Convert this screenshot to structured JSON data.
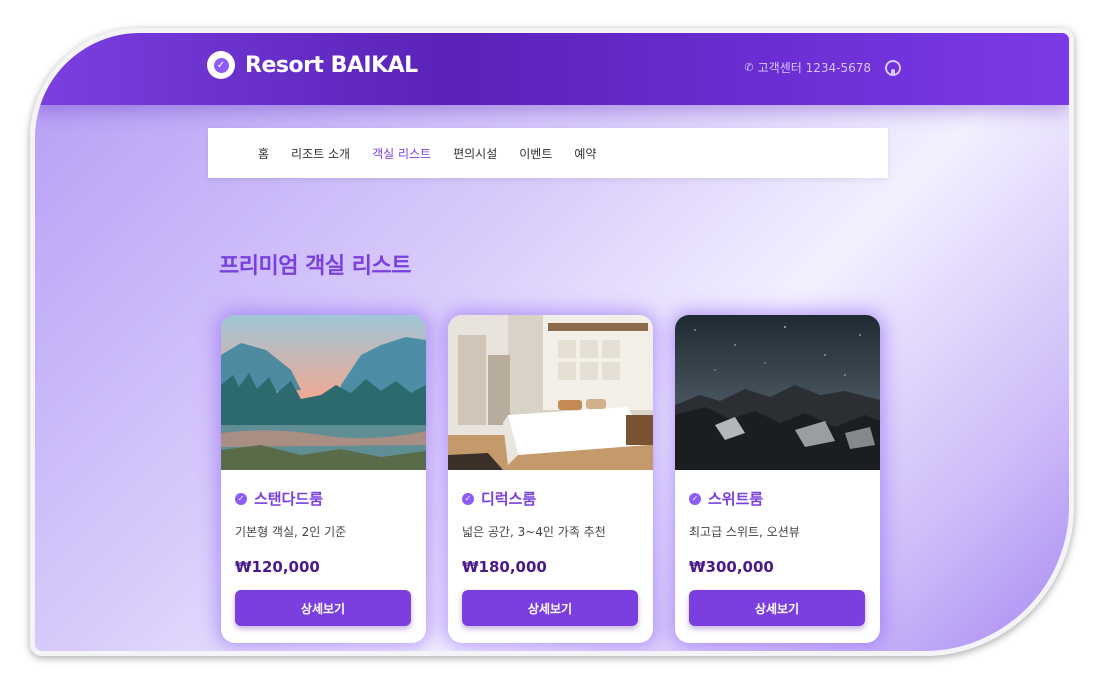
{
  "brand": {
    "name": "Resort BAIKAL",
    "icon": "check-circle-icon"
  },
  "contact": {
    "phone_label": "고객센터 1234-5678",
    "phone_icon": "phone-icon",
    "github_icon": "github-icon"
  },
  "nav": {
    "items": [
      {
        "label": "홈",
        "active": false
      },
      {
        "label": "리조트 소개",
        "active": false
      },
      {
        "label": "객실 리스트",
        "active": true
      },
      {
        "label": "편의시설",
        "active": false
      },
      {
        "label": "이벤트",
        "active": false
      },
      {
        "label": "예약",
        "active": false
      }
    ]
  },
  "section": {
    "title": "프리미엄 객실 리스트"
  },
  "rooms": [
    {
      "name": "스탠다드룸",
      "desc": "기본형 객실, 2인 기준",
      "price": "₩120,000",
      "button": "상세보기",
      "image": "mountain-lake-photo"
    },
    {
      "name": "디럭스룸",
      "desc": "넓은 공간, 3~4인 가족 추천",
      "price": "₩180,000",
      "button": "상세보기",
      "image": "bedroom-photo"
    },
    {
      "name": "스위트룸",
      "desc": "최고급 스위트, 오션뷰",
      "price": "₩300,000",
      "button": "상세보기",
      "image": "night-mountain-photo"
    }
  ],
  "colors": {
    "accent": "#7b3fe0",
    "price": "#4a1a8c",
    "header": "#5a22b8"
  }
}
